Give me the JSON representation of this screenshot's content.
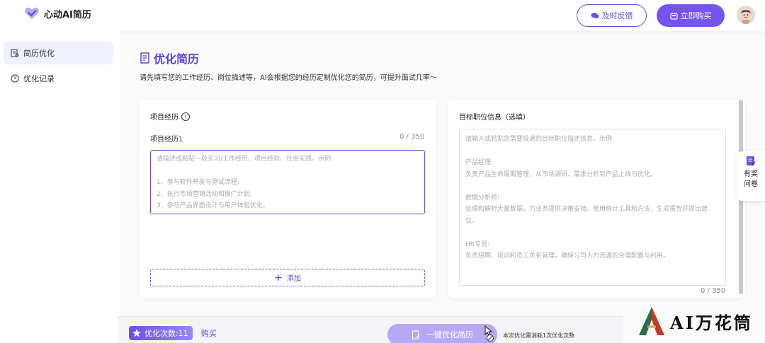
{
  "app": {
    "name": "心动AI简历"
  },
  "header": {
    "feedback_label": "及时反馈",
    "buy_label": "立即购买"
  },
  "sidebar": {
    "items": [
      {
        "label": "简历优化",
        "icon": "resume-icon"
      },
      {
        "label": "优化记录",
        "icon": "history-icon"
      }
    ]
  },
  "page": {
    "title": "优化简历",
    "description": "请先填写您的工作经历、岗位描述等，AI会根据您的经历定制优化您的简历，可提升面试几率～"
  },
  "left_card": {
    "heading": "项目经历",
    "sub_label": "项目经历1",
    "counter": "0 / 350",
    "placeholder": "请描述或粘贴一段实习/工作经历、项目经验、社会实践，示例:\n\n1、参与软件开发与测试流程;\n2、执行市场营销活动和推广计划;\n3、参与产品界面设计与用户体验优化。",
    "add_label": "添加"
  },
  "right_card": {
    "heading": "目标职位信息（选填）",
    "counter": "0 / 350",
    "placeholder": "请输入或粘贴您需要投递的目标职位描述信息，示例:\n\n产品经理:\n负责产品生命周期管理，从市场调研、需求分析到产品上线与优化。\n\n数据分析师:\n处理和解析大量数据，为业务提供决策支持。使用统计工具和方法，生成报告并提出建议。\n\nHR专员:\n负责招聘、培训和员工关系管理，确保公司人力资源的合理配置与利用。"
  },
  "reward": {
    "line1": "有奖",
    "line2": "问卷"
  },
  "bottom": {
    "quota_label": "优化次数:11",
    "buy_label": "购买",
    "optimize_label": "一键优化简历",
    "note": "本次优化需消耗1次优化次数"
  },
  "watermark": {
    "text": "AI万花筒"
  },
  "colors": {
    "accent": "#6c4fe0",
    "accent_light": "#b8a8f4"
  }
}
